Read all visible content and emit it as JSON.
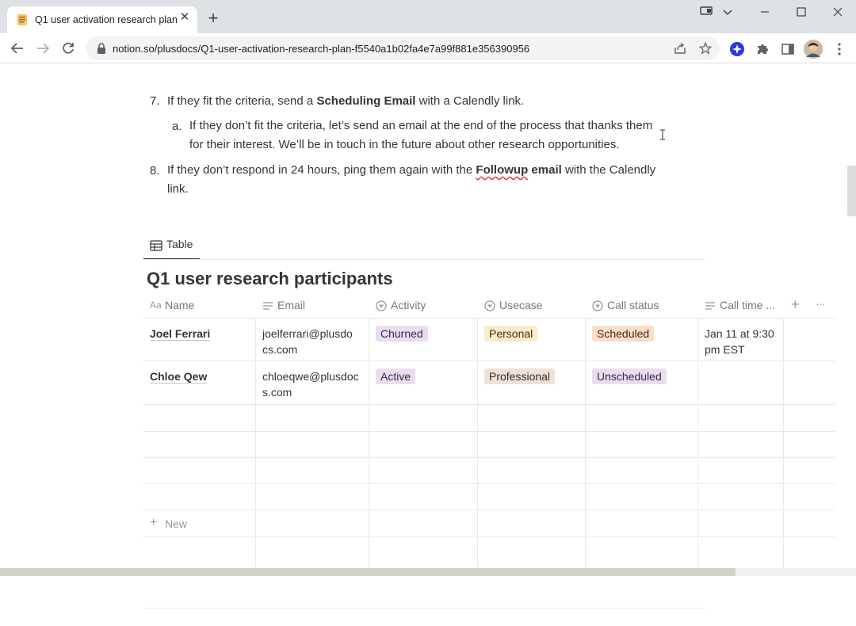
{
  "browser": {
    "tab_title": "Q1 user activation research plan",
    "url": "notion.so/plusdocs/Q1-user-activation-research-plan-f5540a1b02fa4e7a99f881e356390956"
  },
  "doc": {
    "item7_num": "7.",
    "item7_pre": "If they fit the criteria, send a ",
    "item7_bold": "Scheduling Email",
    "item7_post": " with a Calendly link.",
    "item7a_num": "a.",
    "item7a_line1": "If they don’t fit the criteria, let’s send an email at the end of the process that thanks them",
    "item7a_line2": "for their interest. We’ll be in touch in the future about other research opportunities.",
    "item8_num": "8.",
    "item8_pre": "If they don’t respond in 24 hours, ping them again with the ",
    "item8_bold_a": "Followup",
    "item8_bold_b": " email",
    "item8_post": " with the Calendly",
    "item8_line2": "link."
  },
  "database": {
    "view_tab": "Table",
    "title": "Q1 user research participants",
    "columns": [
      "Name",
      "Email",
      "Activity",
      "Usecase",
      "Call status",
      "Call time ..."
    ],
    "rows": [
      {
        "name": "Joel Ferrari",
        "email_l1": "joelferrari@plusdo",
        "email_l2": "cs.com",
        "activity": "Churned",
        "usecase": "Personal",
        "call_status": "Scheduled",
        "call_time_l1": "Jan 11 at 9:30",
        "call_time_l2": "pm EST"
      },
      {
        "name": "Chloe Qew",
        "email_l1": "chloeqwe@plusdoc",
        "email_l2": "s.com",
        "activity": "Active",
        "usecase": "Professional",
        "call_status": "Unscheduled",
        "call_time_l1": "",
        "call_time_l2": ""
      }
    ],
    "new_label": "New",
    "add_column": "+",
    "more": "···"
  },
  "colors": {
    "tag_purple_bg": "#e8deee",
    "tag_orange_bg": "#fadec9",
    "tag_yellow_bg": "#fdecc8",
    "tag_brown_bg": "#eee0da"
  }
}
